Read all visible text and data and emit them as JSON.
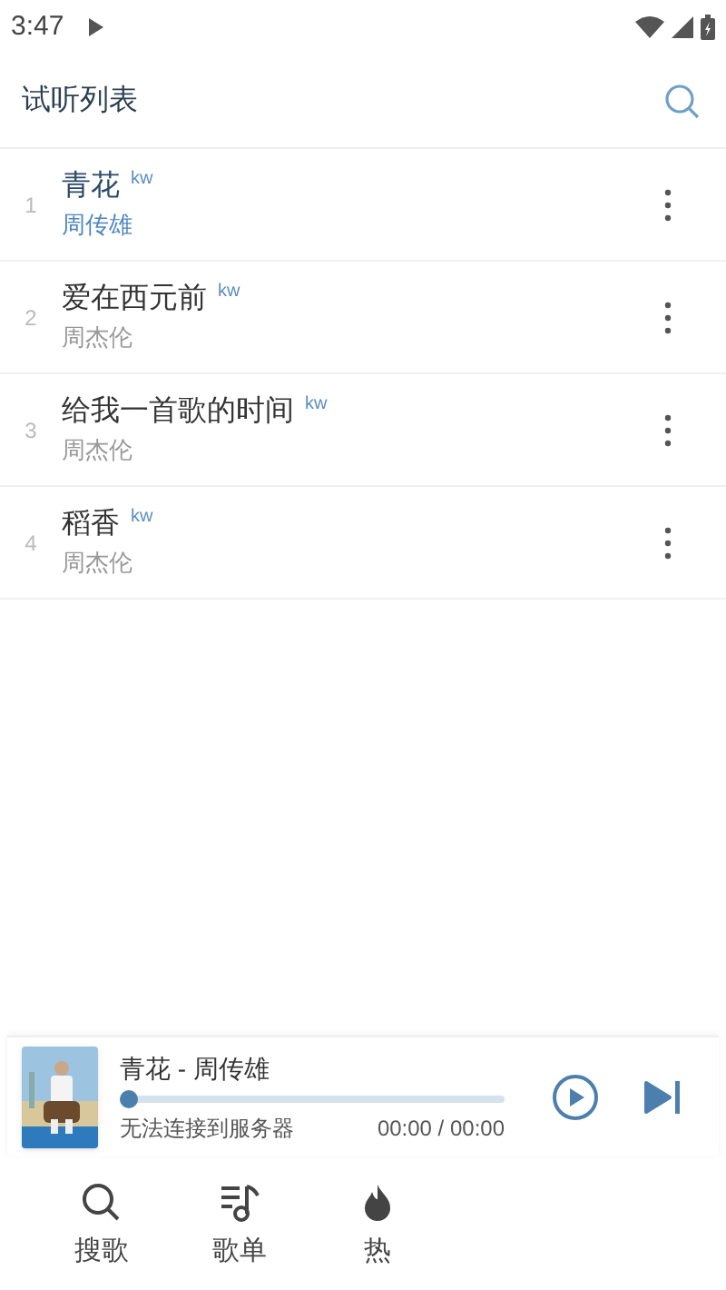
{
  "status_bar": {
    "time": "3:47"
  },
  "header": {
    "title": "试听列表"
  },
  "songs": [
    {
      "index": "1",
      "title": "青花",
      "source": "kw",
      "artist": "周传雄",
      "selected": true
    },
    {
      "index": "2",
      "title": "爱在西元前",
      "source": "kw",
      "artist": "周杰伦",
      "selected": false
    },
    {
      "index": "3",
      "title": "给我一首歌的时间",
      "source": "kw",
      "artist": "周杰伦",
      "selected": false
    },
    {
      "index": "4",
      "title": "稻香",
      "source": "kw",
      "artist": "周杰伦",
      "selected": false
    }
  ],
  "player": {
    "kind": "picture",
    "title": "青花 - 周传雄",
    "status": "无法连接到服务器",
    "time": "00:00 / 00:00",
    "level": 0
  },
  "nav": [
    {
      "label": "搜歌"
    },
    {
      "label": "歌单"
    },
    {
      "label": "热"
    }
  ]
}
